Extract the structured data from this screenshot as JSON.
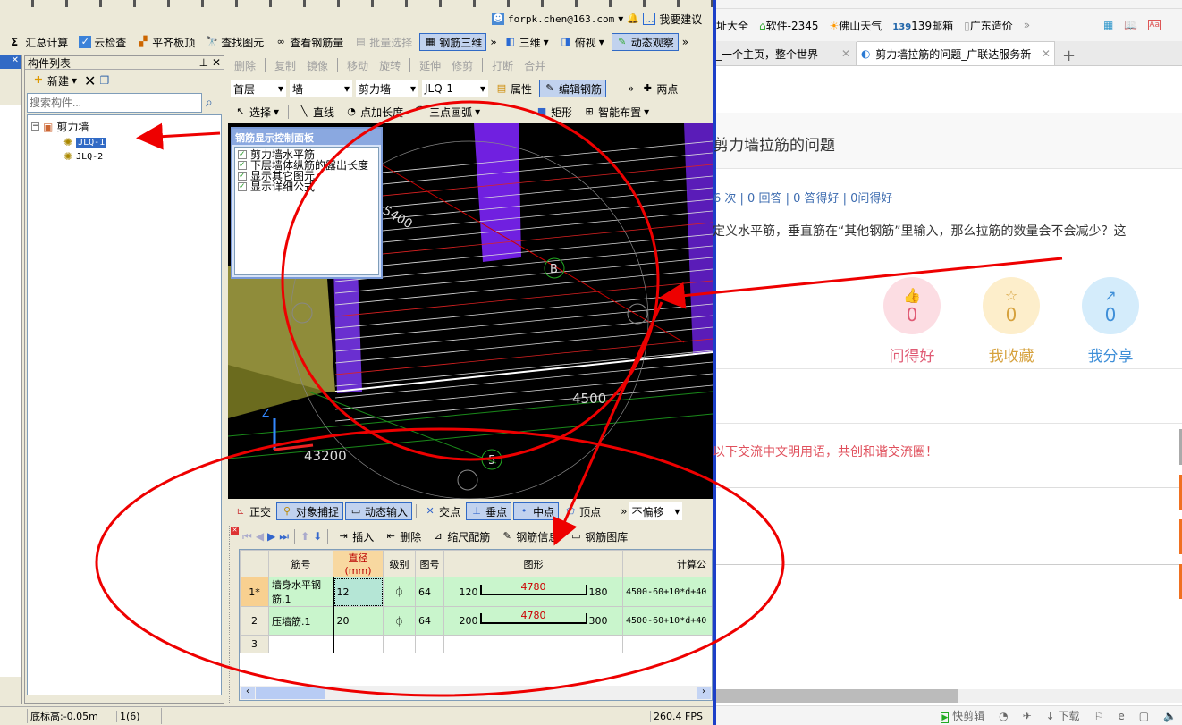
{
  "app": {
    "user": "forpk.chen@163.com",
    "suggest": "我要建议",
    "main_toolbar": [
      "汇总计算",
      "云检查",
      "平齐板顶",
      "查找图元",
      "查看钢筋量",
      "批量选择",
      "钢筋三维",
      "三维",
      "俯视",
      "动态观察"
    ],
    "panel_title": "构件列表",
    "new_label": "新建",
    "search_placeholder": "搜索构件...",
    "tree": {
      "root": "剪力墙",
      "items": [
        "JLQ-1",
        "JLQ-2"
      ]
    },
    "edit_toolbar": [
      "删除",
      "复制",
      "镜像",
      "移动",
      "旋转",
      "延伸",
      "修剪",
      "打断",
      "合并"
    ],
    "combos": [
      "首层",
      "墙",
      "剪力墙",
      "JLQ-1"
    ],
    "props_label": "属性",
    "edit_rebar_label": "编辑钢筋",
    "two_point": "两点",
    "draw_toolbar": [
      "选择",
      "直线",
      "点加长度",
      "三点画弧",
      "矩形",
      "智能布置"
    ],
    "rebar_panel": {
      "title": "钢筋显示控制面板",
      "options": [
        "剪力墙水平筋",
        "下层墙体纵筋的露出长度",
        "显示其它图元",
        "显示详细公式"
      ]
    },
    "viewport_labels": {
      "dim1": "5400",
      "dim2": "4500",
      "dim3": "43200",
      "axis_b": "B",
      "axis_5": "5",
      "axis_z": "Z"
    },
    "snap_toolbar": [
      "正交",
      "对象捕捉",
      "动态输入",
      "交点",
      "垂点",
      "中点",
      "顶点"
    ],
    "offset_select": "不偏移",
    "table_toolbar": [
      "插入",
      "删除",
      "缩尺配筋",
      "钢筋信息",
      "钢筋图库"
    ],
    "table": {
      "headers": [
        "筋号",
        "直径(mm)",
        "级别",
        "图号",
        "图形",
        "计算公"
      ],
      "rows": [
        {
          "idx": "1*",
          "name": "墙身水平钢筋.1",
          "dia": "12",
          "grade": "⏀",
          "fig": "64",
          "left": "120",
          "len": "4780",
          "right": "180",
          "formula": "4500-60+10*d+40"
        },
        {
          "idx": "2",
          "name": "压墙筋.1",
          "dia": "20",
          "grade": "⏀",
          "fig": "64",
          "left": "200",
          "len": "4780",
          "right": "300",
          "formula": "4500-60+10*d+40"
        },
        {
          "idx": "3",
          "name": "",
          "dia": "",
          "grade": "",
          "fig": "",
          "left": "",
          "len": "",
          "right": "",
          "formula": ""
        }
      ]
    },
    "status": {
      "elevation": "底标高:-0.05m",
      "count": "1(6)",
      "fps": "260.4 FPS"
    }
  },
  "browser": {
    "bookmarks": [
      "址大全",
      "软件-2345",
      "佛山天气",
      "139邮箱",
      "广东造价"
    ],
    "tabs": [
      "_一个主页，整个世界",
      "剪力墙拉筋的问题_广联达服务新"
    ],
    "title": "剪力墙拉筋的问题",
    "stats": "6 次 | 0 回答 | 0 答得好 | 0问得好",
    "question": "定义水平筋，垂直筋在“其他钢筋”里输入，那么拉筋的数量会不会减少？这",
    "actions": [
      {
        "count": "0",
        "label": "问得好"
      },
      {
        "count": "0",
        "label": "我收藏"
      },
      {
        "count": "0",
        "label": "我分享"
      }
    ],
    "notice": "以下交流中文明用语，共创和谐交流圈！",
    "statusbar": [
      "快剪辑",
      "下载"
    ]
  }
}
